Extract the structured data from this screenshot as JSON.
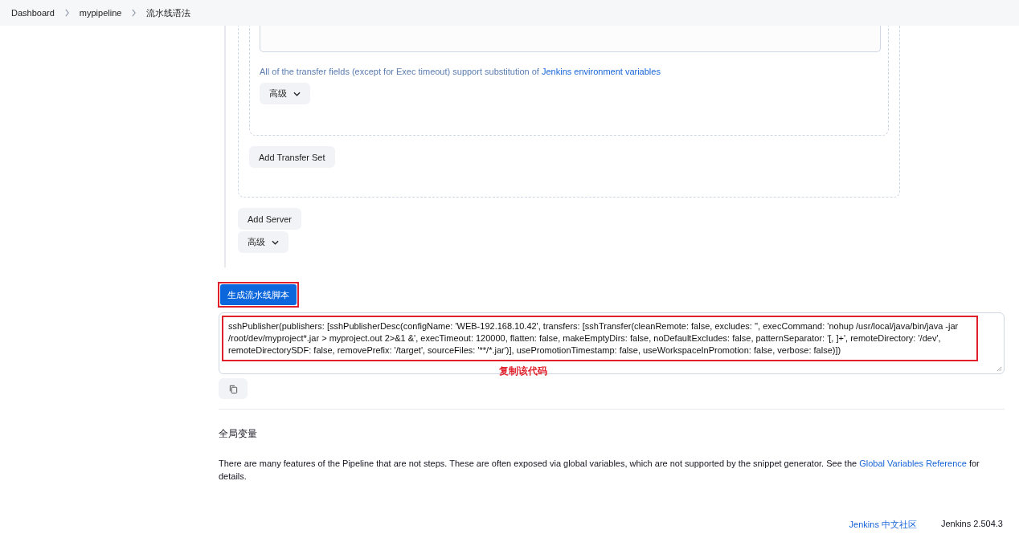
{
  "breadcrumbs": [
    "Dashboard",
    "mypipeline",
    "流水线语法"
  ],
  "transfer_note": {
    "text": "All of the transfer fields (except for Exec timeout) support substitution of ",
    "link": "Jenkins environment variables"
  },
  "advanced_button": "高级",
  "add_transfer_set": "Add Transfer Set",
  "add_server": "Add Server",
  "server_advanced_button": "高级",
  "generate_button": "生成流水线脚本",
  "script": "sshPublisher(publishers: [sshPublisherDesc(configName: 'WEB-192.168.10.42', transfers: [sshTransfer(cleanRemote: false, excludes: '', execCommand: 'nohup /usr/local/java/bin/java -jar /root/dev/myproject*.jar > myproject.out 2>&1 &', execTimeout: 120000, flatten: false, makeEmptyDirs: false, noDefaultExcludes: false, patternSeparator: '[, ]+', remoteDirectory: '/dev', remoteDirectorySDF: false, removePrefix: '/target', sourceFiles: '**/*.jar')], usePromotionTimestamp: false, useWorkspaceInPromotion: false, verbose: false)])",
  "annotation": "复制该代码",
  "global_vars": {
    "title": "全局变量",
    "text": "There are many features of the Pipeline that are not steps. These are often exposed via global variables, which are not supported by the snippet generator. See the ",
    "link": "Global Variables Reference",
    "after": " for details."
  },
  "footer": {
    "link": "Jenkins 中文社区",
    "version": "Jenkins 2.504.3"
  }
}
